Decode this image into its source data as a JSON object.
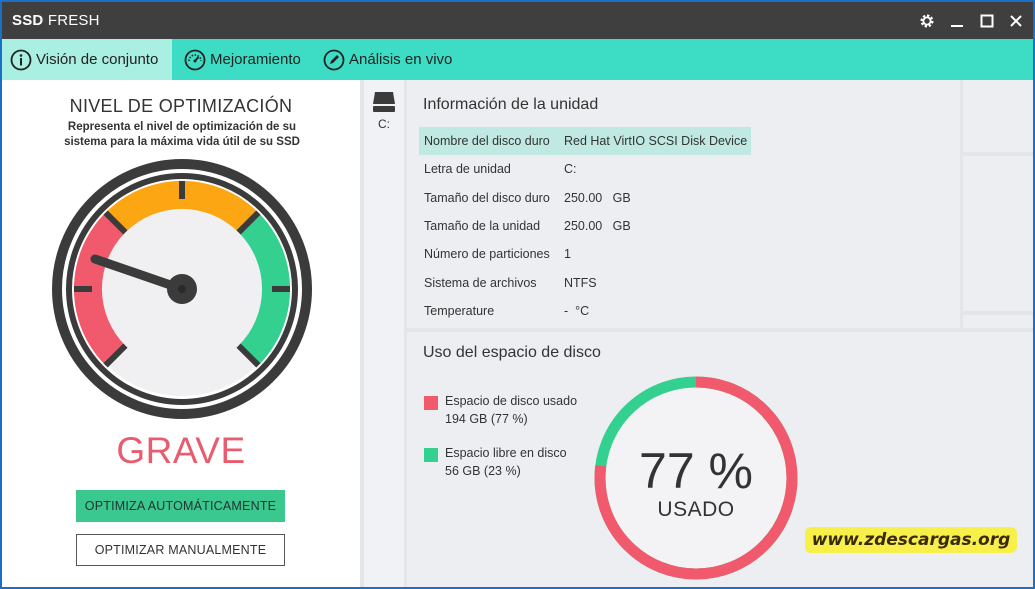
{
  "window": {
    "title_bold": "SSD",
    "title_rest": "FRESH",
    "buttons": {
      "settings": "gear-icon",
      "minimize": "minimize-icon",
      "maximize": "maximize-icon",
      "close": "close-icon"
    }
  },
  "tabs": [
    {
      "label": "Visión de conjunto",
      "icon": "info-icon",
      "active": true
    },
    {
      "label": "Mejoramiento",
      "icon": "speedometer-icon",
      "active": false
    },
    {
      "label": "Análisis en vivo",
      "icon": "pencil-icon",
      "active": false
    }
  ],
  "optimization": {
    "title": "NIVEL DE OPTIMIZACIÓN",
    "description": "Representa el nivel de optimización de su sistema para la máxima vida útil de su SSD",
    "status": "GRAVE",
    "auto_button": "OPTIMIZA AUTOMÁTICAMENTE",
    "manual_button": "OPTIMIZAR MANUALMENTE",
    "colors": {
      "red": "#f05a6c",
      "orange": "#fda614",
      "green": "#34d08f",
      "status": "#e85d6e"
    }
  },
  "drive": {
    "label": "C:",
    "icon": "drive-icon"
  },
  "info": {
    "title": "Información de la unidad",
    "rows": [
      {
        "label": "Nombre del disco duro",
        "value": "Red Hat VirtIO SCSI Disk Device"
      },
      {
        "label": "Letra de unidad",
        "value": "C:"
      },
      {
        "label": "Tamaño del disco duro",
        "value": "250.00   GB"
      },
      {
        "label": "Tamaño de la unidad",
        "value": "250.00   GB"
      },
      {
        "label": "Número de particiones",
        "value": "1"
      },
      {
        "label": "Sistema de archivos",
        "value": "NTFS"
      },
      {
        "label": "Temperature",
        "value": "-  °C"
      }
    ]
  },
  "usage": {
    "title": "Uso del espacio de disco",
    "used_label": "Espacio de disco usado",
    "used_value": "194 GB (77 %)",
    "free_label": "Espacio libre en disco",
    "free_value": "56 GB (23 %)",
    "percent_text": "77 %",
    "center_label": "USADO",
    "used_fraction": 0.77,
    "used_color": "#f05a6c",
    "free_color": "#34d08f"
  },
  "watermark": "www.zdescargas.org"
}
